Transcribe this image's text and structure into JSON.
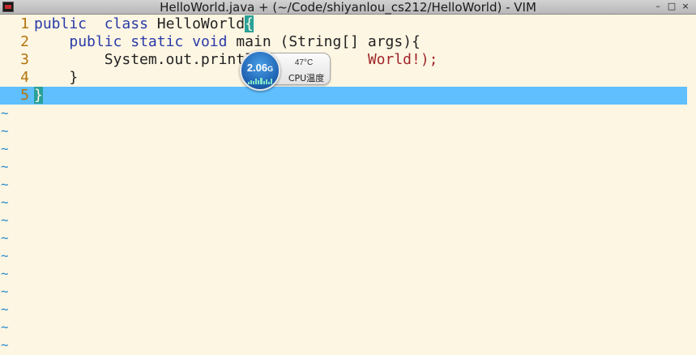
{
  "window": {
    "title": "HelloWorld.java + (~/Code/shiyanlou_cs212/HelloWorld) - VIM",
    "controls": {
      "minimize": "–",
      "maximize": "□",
      "close": "×"
    }
  },
  "editor": {
    "lines": [
      {
        "num": "1",
        "tokens": [
          {
            "t": "kw",
            "v": "public"
          },
          {
            "t": "plain",
            "v": "  "
          },
          {
            "t": "kw",
            "v": "class"
          },
          {
            "t": "plain",
            "v": " HelloWorld"
          },
          {
            "t": "brace",
            "v": "{"
          }
        ]
      },
      {
        "num": "2",
        "tokens": [
          {
            "t": "plain",
            "v": "    "
          },
          {
            "t": "kw",
            "v": "public"
          },
          {
            "t": "plain",
            "v": " "
          },
          {
            "t": "kw",
            "v": "static"
          },
          {
            "t": "plain",
            "v": " "
          },
          {
            "t": "kw",
            "v": "void"
          },
          {
            "t": "plain",
            "v": " main (String[] args){"
          }
        ]
      },
      {
        "num": "3",
        "tokens": [
          {
            "t": "plain",
            "v": "        System.out.printl"
          },
          {
            "t": "plain",
            "v": "             "
          },
          {
            "t": "str",
            "v": "World!);"
          }
        ]
      },
      {
        "num": "4",
        "tokens": [
          {
            "t": "plain",
            "v": "    }"
          }
        ]
      },
      {
        "num": "5",
        "tokens": [
          {
            "t": "brace",
            "v": "}"
          }
        ]
      }
    ],
    "empty_line_marker": "~",
    "empty_line_count": 14
  },
  "cpu_widget": {
    "value": "2.06",
    "unit": "G",
    "temperature": "47°C",
    "label": "CPU温度",
    "usage_bars": [
      0.3,
      0.55,
      0.4,
      0.7,
      0.5,
      0.85,
      0.45,
      0.6,
      0.35,
      0.75
    ]
  },
  "colors": {
    "background": "#fdf6e3",
    "cursorline": "#5fbfff",
    "line_number": "#b2740c",
    "keyword": "#2a3aa8",
    "string": "#a0262a",
    "tilde": "#2d8ccf",
    "match_brace": "#2aa198"
  }
}
